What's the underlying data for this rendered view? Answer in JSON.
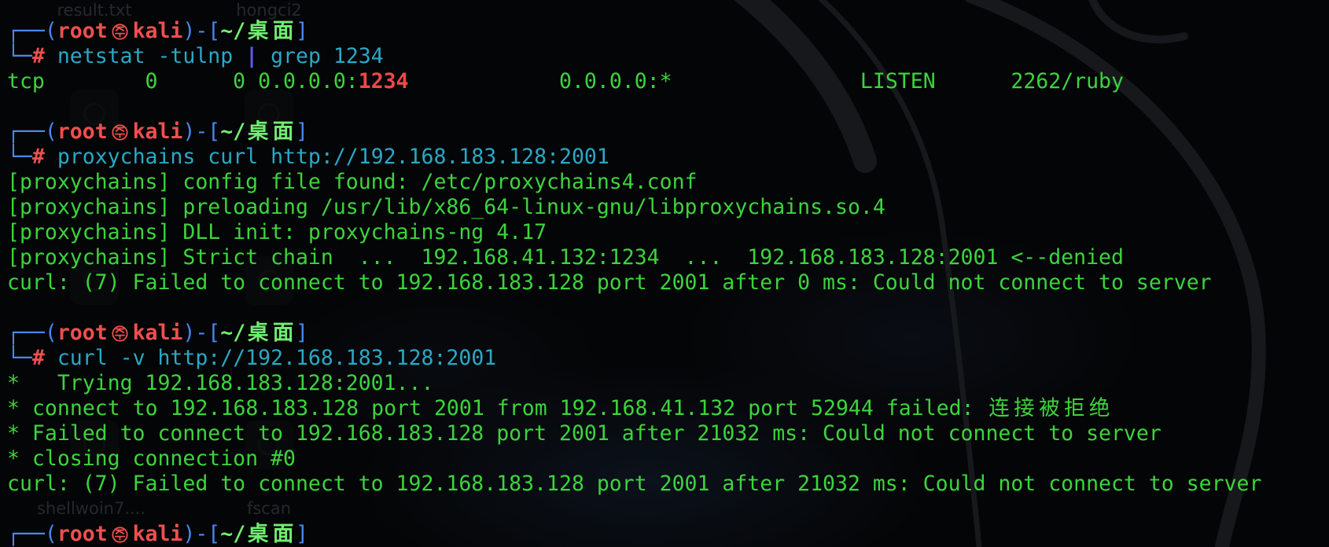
{
  "colors": {
    "background": "#040506",
    "prompt_box": "#4a86f0",
    "prompt_user": "#ef4f4f",
    "prompt_path": "#72ee72",
    "prompt_symbol": "#ef4f4f",
    "command": "#2aa8c6",
    "pipe": "#5f5cf4",
    "output": "#3cd43c",
    "grep_match": "#f24848",
    "wallpaper_stroke": "#16181c",
    "desktop_label": "#25282c"
  },
  "desktop": {
    "icons": [
      {
        "label": "result.txt"
      },
      {
        "label": "hongci2"
      },
      {
        "label": "shellwoin7...."
      },
      {
        "label": "fscan"
      }
    ]
  },
  "terminal": {
    "prompt": {
      "box_top": "┌──(",
      "user": "root",
      "separator_icon": "kali-at-icon",
      "host": "kali",
      "path_open": ")-[",
      "path": "~/桌面",
      "path_close": "]",
      "box_bottom": "└─",
      "symbol": "#"
    },
    "session": [
      {
        "command": [
          "netstat -tulnp ",
          "|",
          " grep 1234"
        ],
        "output": [
          {
            "before": "tcp        0      0 0.0.0.0:",
            "match": "1234",
            "after": "            0.0.0.0:*               LISTEN      2262/ruby"
          }
        ]
      },
      {
        "command": [
          "proxychains curl http://192.168.183.128:2001"
        ],
        "output": [
          "[proxychains] config file found: /etc/proxychains4.conf",
          "[proxychains] preloading /usr/lib/x86_64-linux-gnu/libproxychains.so.4",
          "[proxychains] DLL init: proxychains-ng 4.17",
          "[proxychains] Strict chain  ...  192.168.41.132:1234  ...  192.168.183.128:2001 <--denied",
          "curl: (7) Failed to connect to 192.168.183.128 port 2001 after 0 ms: Could not connect to server"
        ]
      },
      {
        "command": [
          "curl -v http://192.168.183.128:2001"
        ],
        "output": [
          "*   Trying 192.168.183.128:2001...",
          "* connect to 192.168.183.128 port 2001 from 192.168.41.132 port 52944 failed: 连接被拒绝",
          "* Failed to connect to 192.168.183.128 port 2001 after 21032 ms: Could not connect to server",
          "* closing connection #0",
          "curl: (7) Failed to connect to 192.168.183.128 port 2001 after 21032 ms: Could not connect to server"
        ]
      }
    ]
  }
}
